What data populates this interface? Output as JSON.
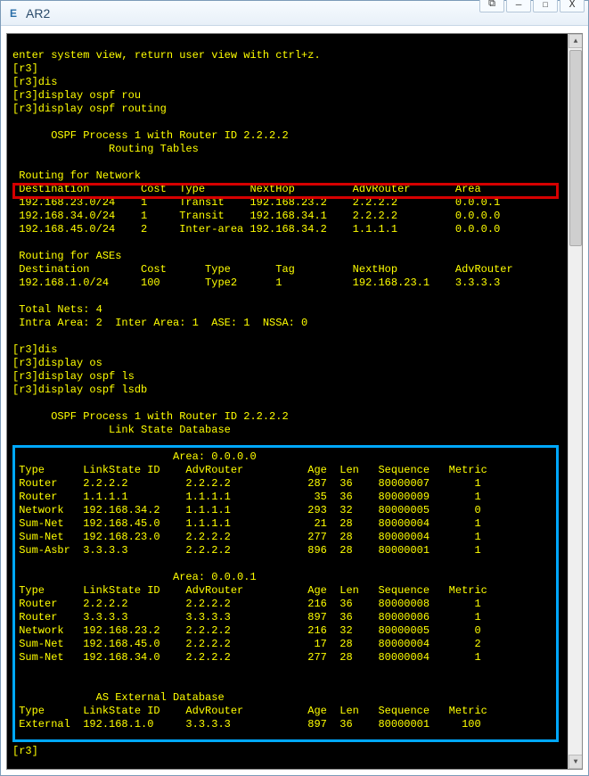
{
  "window": {
    "title": "AR2",
    "icon_label": "E"
  },
  "term": {
    "cutoff": "enter system view, return user view with ctrl+z.",
    "p1": "[r3]",
    "p2": "[r3]dis",
    "p3": "[r3]display ospf rou",
    "p4": "[r3]display ospf routing",
    "blank": "",
    "ospf_proc": "      OSPF Process 1 with Router ID 2.2.2.2",
    "rt_tables": "               Routing Tables",
    "rfn": " Routing for Network",
    "rfn_hdr": " Destination        Cost  Type       NextHop         AdvRouter       Area",
    "rfn_r1": " 192.168.23.0/24    1     Transit    192.168.23.2    2.2.2.2         0.0.0.1",
    "rfn_r2": " 192.168.34.0/24    1     Transit    192.168.34.1    2.2.2.2         0.0.0.0",
    "rfn_r3": " 192.168.45.0/24    2     Inter-area 192.168.34.2    1.1.1.1         0.0.0.0",
    "rfa": " Routing for ASEs",
    "rfa_hdr": " Destination        Cost      Type       Tag         NextHop         AdvRouter",
    "rfa_r1": " 192.168.1.0/24     100       Type2      1           192.168.23.1    3.3.3.3",
    "totals1": " Total Nets: 4",
    "totals2": " Intra Area: 2  Inter Area: 1  ASE: 1  NSSA: 0",
    "p5": "[r3]dis",
    "p6": "[r3]display os",
    "p7": "[r3]display ospf ls",
    "p8": "[r3]display ospf lsdb",
    "lsd": "               Link State Database",
    "area0": "                         Area: 0.0.0.0",
    "lsdb_hdr": " Type      LinkState ID    AdvRouter          Age  Len   Sequence   Metric",
    "a0_r1": " Router    2.2.2.2         2.2.2.2            287  36    80000007       1",
    "a0_r2": " Router    1.1.1.1         1.1.1.1             35  36    80000009       1",
    "a0_r3": " Network   192.168.34.2    1.1.1.1            293  32    80000005       0",
    "a0_r4": " Sum-Net   192.168.45.0    1.1.1.1             21  28    80000004       1",
    "a0_r5": " Sum-Net   192.168.23.0    2.2.2.2            277  28    80000004       1",
    "a0_r6": " Sum-Asbr  3.3.3.3         2.2.2.2            896  28    80000001       1",
    "area1": "                         Area: 0.0.0.1",
    "a1_r1": " Router    2.2.2.2         2.2.2.2            216  36    80000008       1",
    "a1_r2": " Router    3.3.3.3         3.3.3.3            897  36    80000006       1",
    "a1_r3": " Network   192.168.23.2    2.2.2.2            216  32    80000005       0",
    "a1_r4": " Sum-Net   192.168.45.0    2.2.2.2             17  28    80000004       2",
    "a1_r5": " Sum-Net   192.168.34.0    2.2.2.2            277  28    80000004       1",
    "asext": "             AS External Database",
    "ex_r1": " External  192.168.1.0     3.3.3.3            897  36    80000001     100",
    "pend": "[r3]"
  }
}
